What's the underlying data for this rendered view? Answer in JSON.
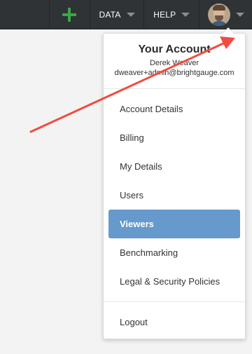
{
  "topbar": {
    "add_icon": "plus-icon",
    "data_label": "DATA",
    "help_label": "HELP",
    "avatar_icon": "avatar-photo",
    "caret_icon": "caret-down-icon"
  },
  "account_menu": {
    "title": "Your Account",
    "name": "Derek Weaver",
    "email": "dweaver+admin@brightgauge.com",
    "items": [
      {
        "label": "Account Details"
      },
      {
        "label": "Billing"
      },
      {
        "label": "My Details"
      },
      {
        "label": "Users"
      },
      {
        "label": "Viewers",
        "active": true
      },
      {
        "label": "Benchmarking"
      },
      {
        "label": "Legal & Security Policies"
      }
    ],
    "logout_label": "Logout"
  },
  "annotation": {
    "arrow_color": "#f24b3f",
    "arrow_icon": "red-arrow-annotation"
  },
  "colors": {
    "topbar_bg": "#2f3336",
    "accent_green": "#3aa848",
    "active_item_bg": "#6699cc"
  }
}
